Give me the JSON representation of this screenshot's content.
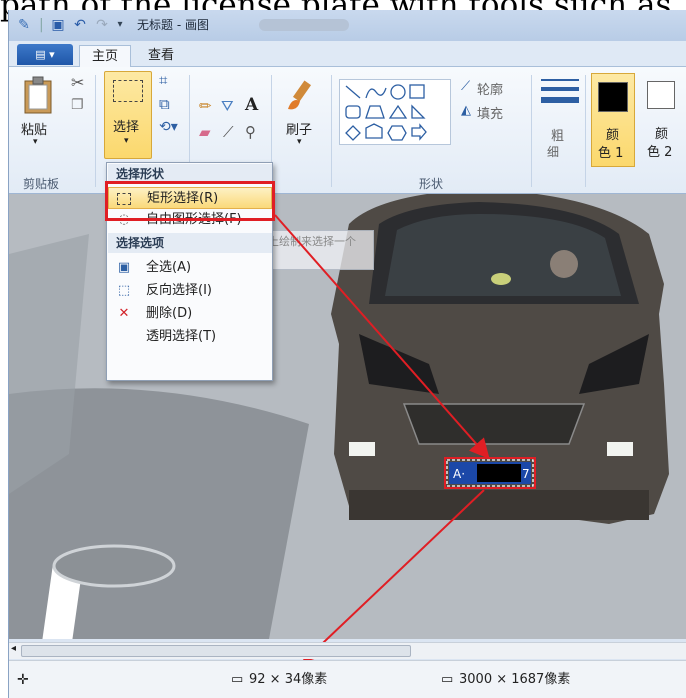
{
  "caption": "path of the license plate with tools such as",
  "window": {
    "title": "无标题 - 画图"
  },
  "tabs": {
    "file_label": "▤ ▾",
    "home": "主页",
    "view": "查看"
  },
  "clipboard": {
    "paste_label": "粘贴",
    "group_label": "剪贴板"
  },
  "image_group": {
    "select_label": "选择"
  },
  "tools_group": {
    "brush_label": "刷子"
  },
  "shapes_group": {
    "outline_label": "轮廓",
    "fill_label": "填充",
    "group_label": "形状"
  },
  "size": {
    "label_line1": "粗",
    "label_line2": "细"
  },
  "colors": {
    "color1_line1": "颜",
    "color1_line2": "色 1",
    "color2_line1": "颜",
    "color2_line2": "色 2",
    "color1_value": "#000000",
    "color2_value": "#ffffff"
  },
  "menu": {
    "shape_header": "选择形状",
    "rect_select": "矩形选择(R)",
    "freeform_select": "自由图形选择(F)",
    "options_header": "选择选项",
    "select_all": "全选(A)",
    "invert_select": "反向选择(I)",
    "delete": "删除(D)",
    "transparent_select": "透明选择(T)"
  },
  "tooltip": {
    "text": "通过在画布上绘制来选择一个矩形区域。"
  },
  "plate": {
    "text": "A·     7"
  },
  "status": {
    "selection_size": "92 × 34像素",
    "image_size": "3000 × 1687像素"
  },
  "accent": {
    "highlight": "#fbd86d",
    "annotation_red": "#e01e24"
  }
}
